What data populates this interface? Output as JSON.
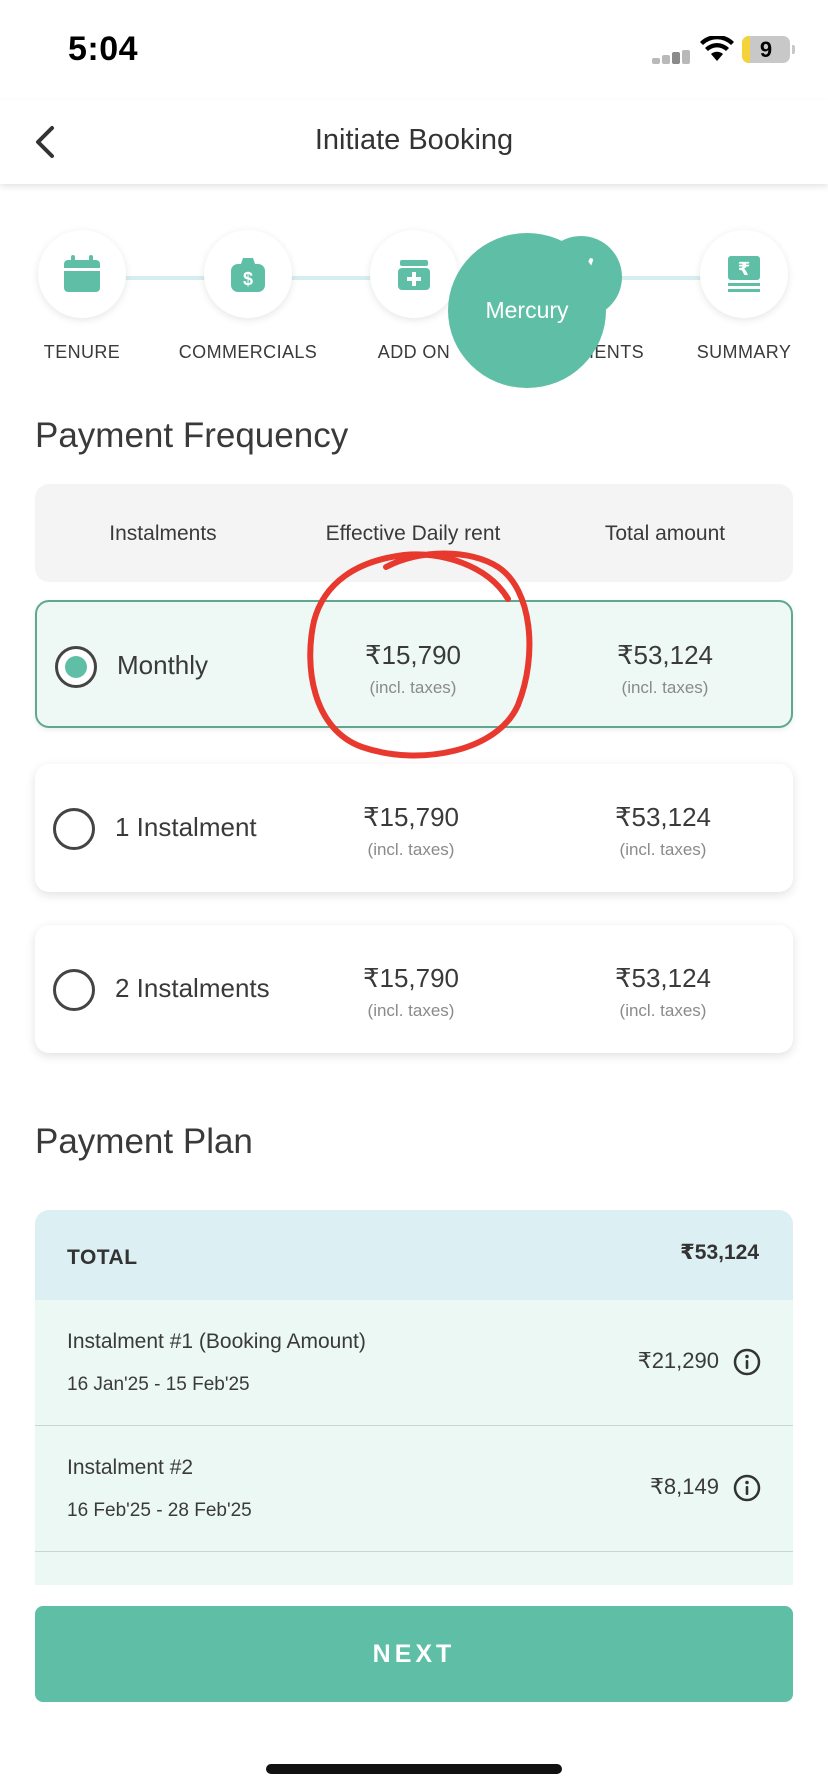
{
  "status_bar": {
    "time": "5:04",
    "battery": "9"
  },
  "header": {
    "title": "Initiate Booking"
  },
  "stepper": {
    "steps": [
      {
        "label": "TENURE",
        "icon": "calendar-icon"
      },
      {
        "label": "COMMERCIALS",
        "icon": "money-bag-icon"
      },
      {
        "label": "ADD ON",
        "icon": "add-on-icon"
      },
      {
        "label": "HIENTS",
        "icon": "check-icon"
      },
      {
        "label": "SUMMARY",
        "icon": "rupee-receipt-icon"
      }
    ],
    "overlay_label": "Mercury"
  },
  "payment_frequency": {
    "title": "Payment Frequency",
    "columns": [
      "Instalments",
      "Effective Daily rent",
      "Total amount"
    ],
    "options": [
      {
        "label": "Monthly",
        "daily_rent": "₹15,790",
        "daily_note": "(incl. taxes)",
        "total": "₹53,124",
        "total_note": "(incl. taxes)",
        "selected": true
      },
      {
        "label": "1 Instalment",
        "daily_rent": "₹15,790",
        "daily_note": "(incl. taxes)",
        "total": "₹53,124",
        "total_note": "(incl. taxes)",
        "selected": false
      },
      {
        "label": "2 Instalments",
        "daily_rent": "₹15,790",
        "daily_note": "(incl. taxes)",
        "total": "₹53,124",
        "total_note": "(incl. taxes)",
        "selected": false
      }
    ]
  },
  "payment_plan": {
    "title": "Payment Plan",
    "total_label": "TOTAL",
    "total_amount": "₹53,124",
    "rows": [
      {
        "title": "Instalment #1 (Booking Amount)",
        "dates": "16 Jan'25 - 15 Feb'25",
        "amount": "₹21,290"
      },
      {
        "title": "Instalment #2",
        "dates": "16 Feb'25 - 28 Feb'25",
        "amount": "₹8,149"
      }
    ]
  },
  "next_button": {
    "label": "NEXT"
  },
  "colors": {
    "accent": "#5fbfa6",
    "total_bg": "#dcf0f3",
    "row_bg": "#ecf8f3",
    "annotation": "#e8392f"
  }
}
